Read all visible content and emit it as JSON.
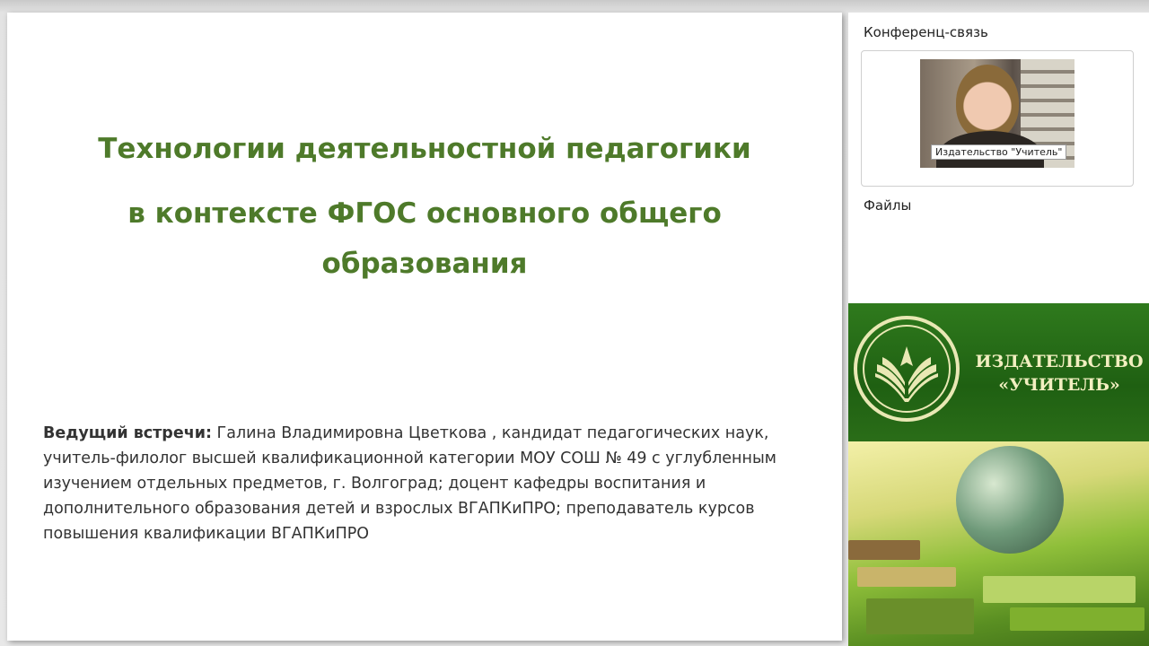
{
  "slide": {
    "title_line1": "Технологии деятельностной педагогики",
    "title_line2": "в контексте ФГОС основного общего",
    "title_line3": "образования",
    "presenter_label": "Ведущий встречи:",
    "presenter_text": " Галина Владимировна Цветкова , кандидат педагогических наук, учитель-филолог высшей квалификационной категории МОУ СОШ № 49 с углубленным изучением отдельных предметов, г. Волгоград; доцент кафедры воспитания и дополнительного образования детей и взрослых ВГАПКиПРО; преподаватель курсов повышения квалификации ВГАПКиПРО"
  },
  "side_panel": {
    "conference_heading": "Конференц-связь",
    "video_caption": "Издательство \"Учитель\"",
    "files_heading": "Файлы"
  },
  "publisher": {
    "name_line1": "ИЗДАТЕЛЬСТВО",
    "name_line2": "«УЧИТЕЛЬ»"
  },
  "colors": {
    "title_green": "#4e7a2a",
    "banner_green": "#1f6012",
    "banner_text": "#f2efc0"
  }
}
